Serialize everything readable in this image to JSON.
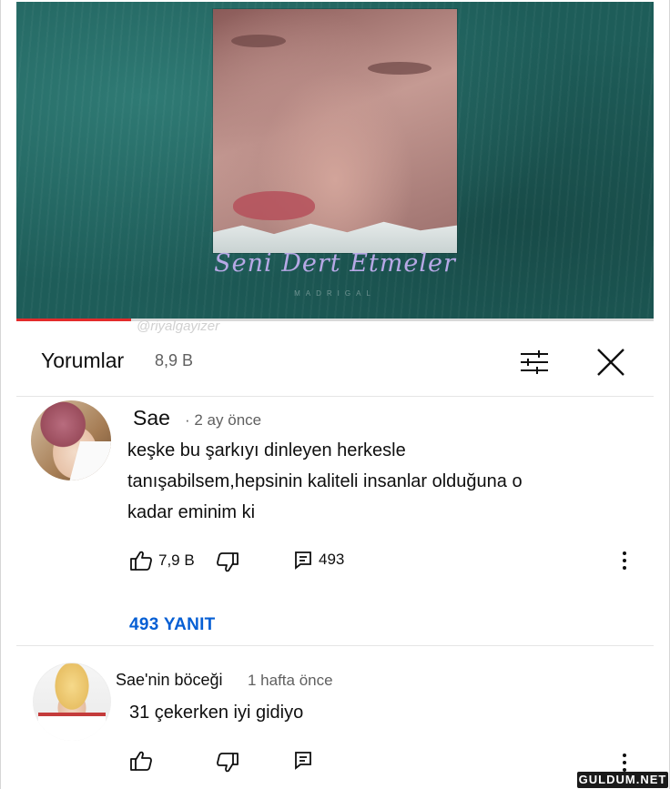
{
  "video": {
    "song_title": "Seni Dert Etmeler",
    "song_subtitle": "MADRIGAL",
    "watermark": "@riyalgayizer",
    "progress": 0.18
  },
  "comments_header": {
    "title": "Yorumlar",
    "count": "8,9 B",
    "sort_icon": "sort-filter-icon",
    "close_icon": "close-icon"
  },
  "comments": [
    {
      "author": "Sae",
      "time": "· 2 ay önce",
      "lines": [
        "keşke bu şarkıyı dinleyen herkesle",
        "tanışabilsem,hepsinin kaliteli insanlar olduğuna o",
        "kadar eminim ki"
      ],
      "likes": "7,9 B",
      "reply_count": "493",
      "replies_link": "493 YANIT"
    },
    {
      "author": "Sae'nin böceği",
      "time": "1 hafta önce",
      "lines": [
        "31 çekerken iyi gidiyo"
      ]
    }
  ],
  "footer": {
    "logo": "GULDUM.NET"
  },
  "colors": {
    "accent_link": "#065fd4",
    "progress": "#e32b2b",
    "video_bg": "#1e5d59"
  }
}
